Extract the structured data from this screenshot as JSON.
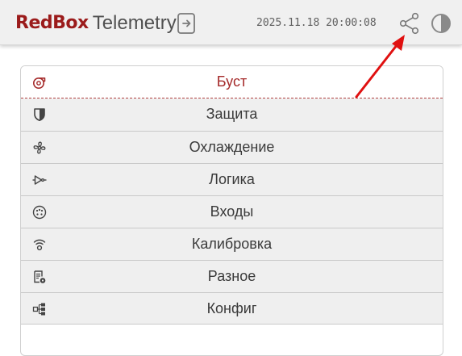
{
  "header": {
    "brand_red": "RedBox",
    "brand_rest": "Telemetry",
    "datetime": "2025.11.18 20:00:08",
    "logout_icon": "logout-icon",
    "share_icon": "share-icon",
    "theme_icon": "theme-toggle-icon"
  },
  "colors": {
    "brand": "#9b1b1b",
    "active_item": "#a52a2a",
    "annotation_arrow": "#e01010",
    "header_bg": "#f0f0f0",
    "item_bg": "#efefef"
  },
  "menu": {
    "items": [
      {
        "label": "Буст",
        "icon": "turbo-icon",
        "active": true
      },
      {
        "label": "Защита",
        "icon": "shield-icon",
        "active": false
      },
      {
        "label": "Охлаждение",
        "icon": "fan-icon",
        "active": false
      },
      {
        "label": "Логика",
        "icon": "logic-gate-icon",
        "active": false
      },
      {
        "label": "Входы",
        "icon": "connector-icon",
        "active": false
      },
      {
        "label": "Калибровка",
        "icon": "sensor-icon",
        "active": false
      },
      {
        "label": "Разное",
        "icon": "document-settings-icon",
        "active": false
      },
      {
        "label": "Конфиг",
        "icon": "config-tree-icon",
        "active": false
      }
    ]
  }
}
